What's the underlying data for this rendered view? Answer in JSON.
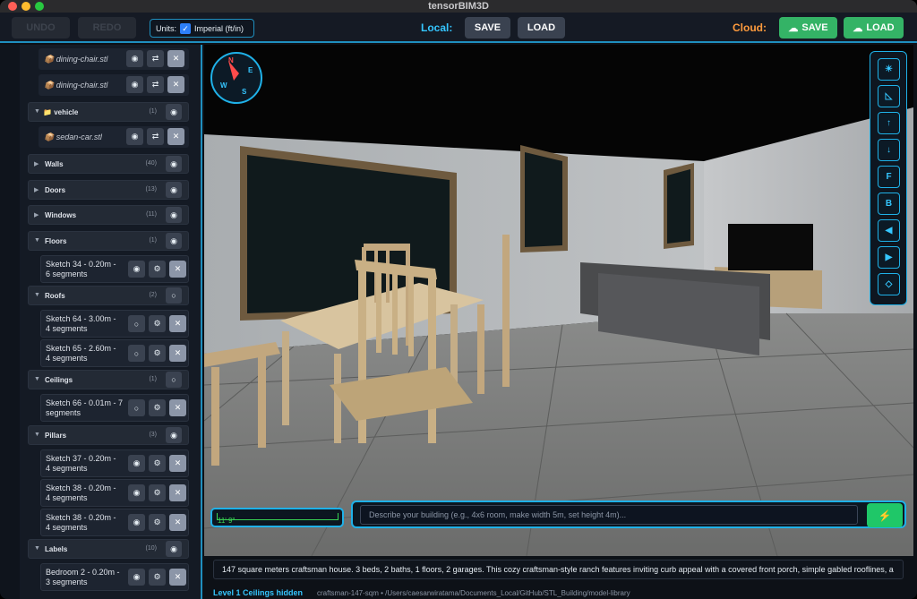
{
  "window": {
    "title": "tensorBIM3D"
  },
  "toolbar": {
    "undo_label": "UNDO",
    "redo_label": "REDO",
    "units_label": "Units:",
    "units_value": "Imperial (ft/in)",
    "local_label": "Local:",
    "local_save": "SAVE",
    "local_load": "LOAD",
    "cloud_label": "Cloud:",
    "cloud_save": "SAVE",
    "cloud_load": "LOAD"
  },
  "sidebar": {
    "files_top": [
      {
        "name": "dining-chair.stl"
      },
      {
        "name": "dining-chair.stl"
      }
    ],
    "vehicle_group": {
      "label": "vehicle",
      "count": "(1)"
    },
    "vehicle_file": {
      "name": "sedan-car.stl"
    },
    "groups": [
      {
        "label": "Walls",
        "count": "(40)"
      },
      {
        "label": "Doors",
        "count": "(13)"
      },
      {
        "label": "Windows",
        "count": "(11)"
      },
      {
        "label": "Floors",
        "count": "(1)"
      },
      {
        "label": "Roofs",
        "count": "(2)"
      },
      {
        "label": "Ceilings",
        "count": "(1)"
      },
      {
        "label": "Pillars",
        "count": "(3)"
      },
      {
        "label": "Labels",
        "count": "(10)"
      }
    ],
    "sketches": {
      "floors": [
        {
          "line1": "Sketch 34 - 0.20m -",
          "line2": "6 segments"
        }
      ],
      "roofs": [
        {
          "line1": "Sketch 64 - 3.00m -",
          "line2": "4 segments"
        },
        {
          "line1": "Sketch 65 - 2.60m -",
          "line2": "4 segments"
        }
      ],
      "ceilings": [
        {
          "line1": "Sketch 66 - 0.01m - 7",
          "line2": "segments"
        }
      ],
      "pillars": [
        {
          "line1": "Sketch 37 - 0.20m -",
          "line2": "4 segments"
        },
        {
          "line1": "Sketch 38 - 0.20m -",
          "line2": "4 segments"
        },
        {
          "line1": "Sketch 38 - 0.20m -",
          "line2": "4 segments"
        }
      ],
      "labels": [
        {
          "line1": "Bedroom 2 - 0.20m -",
          "line2": "3 segments"
        }
      ]
    }
  },
  "viewport": {
    "compass": {
      "n": "N",
      "e": "E",
      "s": "S",
      "w": "W"
    },
    "view_tools": [
      "☀",
      "◺",
      "↑",
      "↓",
      "F",
      "B",
      "◀",
      "▶",
      "◇"
    ],
    "scale_value": "11' 9\"",
    "prompt_placeholder": "Describe your building (e.g., 4x6 room, make width 5m, set height 4m)...",
    "prompt_go": "⚡"
  },
  "description": "147 square meters craftsman house. 3 beds, 2 baths, 1 floors, 2 garages. This cozy craftsman-style ranch features inviting curb appeal with a covered front porch, simple gabled rooflines, a",
  "status": {
    "level": "Level 1 Ceilings hidden",
    "path": "craftsman-147-sqm • /Users/caesarwiratama/Documents_Local/GitHub/STL_Building/model-library"
  },
  "colors": {
    "accent": "#1fb1e8",
    "local": "#35c6ff",
    "cloud": "#ff9b3d",
    "green": "#34b366"
  }
}
